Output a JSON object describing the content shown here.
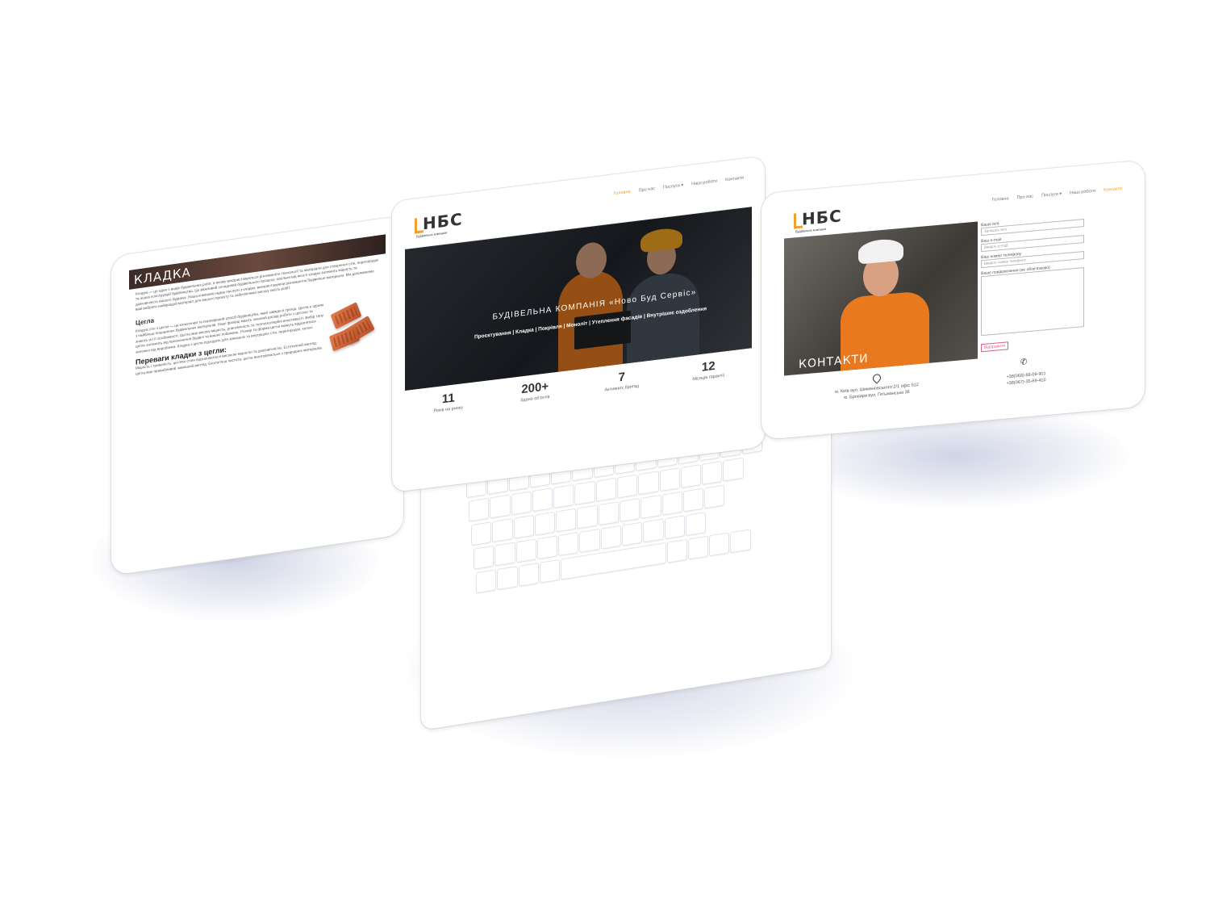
{
  "left_page": {
    "title": "КЛАДКА",
    "intro": "Кладка — це один з видів будівельних робіт, в якому використовуються різноманітні технології та матеріали для створення стін, перегородок та інших конструкцій будівництва. Це важливий складовий будівельного процесу, оскільки від якості кладки залежить міцність та довговічність вашого будинку. Наша компанія надає послуги з кладки, використовуючи різноманітні будівельні матеріали. Ми допоможемо вам вибрати найкращий матеріал для вашого проекту та забезпечимо високу якість робіт.",
    "section_heading": "Цегла",
    "section_text": "Кладка стін з цегли — це класичний та перевірений спосіб будівництва, який завжди в тренді. Цегла є одним з найбільш поширених будівельних матеріалів. Наші фахівці мають значний досвід роботи з цеглою та знають усі її особливості. Цегла має високу міцність, довговічність та теплоізоляційні властивості. Вибір типу цегли залежить від призначення будівлі та ваших побажань. Розмір та форма цегли можуть відрізнятися залежно від виробника. Кладка з цегли підходить для зовнішніх та внутрішніх стін, перегородок, колон.",
    "advantages_heading": "Переваги кладки з цегли:",
    "advantages_text": "Міцність і тривалість: цегляні стіни відзначаються високою міцністю та довговічністю. Естетичний вигляд: цегла має привабливий зовнішній вигляд. Екологічна чистота: цегла виготовляється з природних матеріалів."
  },
  "laptop_page": {
    "logo_text": "НБС",
    "logo_subtitle": "Будівельна компанія",
    "menu": [
      "Головна",
      "Про нас",
      "Послуги ▾",
      "Наші роботи",
      "Контакти"
    ],
    "hero_title": "БУДІВЕЛЬНА КОМПАНІЯ «Ново Буд Сервіс»",
    "hero_subtitle": "Проєктування | Кладка | Покрівля | Моноліт | Утеплення фасадів | Внутрішнє оздоблення",
    "stats": [
      {
        "number": "11",
        "label": "Років на ринку"
      },
      {
        "number": "200+",
        "label": "Здано об'єктів"
      },
      {
        "number": "7",
        "label": "Активних бригад"
      },
      {
        "number": "12",
        "label": "Місяців гарантії"
      }
    ]
  },
  "right_page": {
    "logo_text": "НБС",
    "logo_subtitle": "Будівельна компанія",
    "menu": [
      "Головна",
      "Про нас",
      "Послуги ▾",
      "Наші роботи",
      "Контакти"
    ],
    "photo_title": "КОНТАКТИ",
    "form": {
      "name_label": "Ваше ім'я",
      "name_placeholder": "Запишіть ім'я",
      "email_label": "Ваш e-mail",
      "email_placeholder": "Введіть e-mail",
      "phone_label": "Ваш номер телефону",
      "phone_placeholder": "Введіть номер телефону",
      "message_label": "Ваше повідомлення (не обов'язково)",
      "submit_label": "Відправити"
    },
    "address_line1": "м. Київ вул. Шимановського 2/1 офіс 512",
    "address_line2": "м. Бровари вул. Гетьманська 36",
    "phone1": "+38(068)-88-06-901",
    "phone2": "+38(067)-35-69-410"
  },
  "colors": {
    "accent": "#f0a030",
    "button": "#d9607f",
    "shadow": "#9aa0c8"
  }
}
